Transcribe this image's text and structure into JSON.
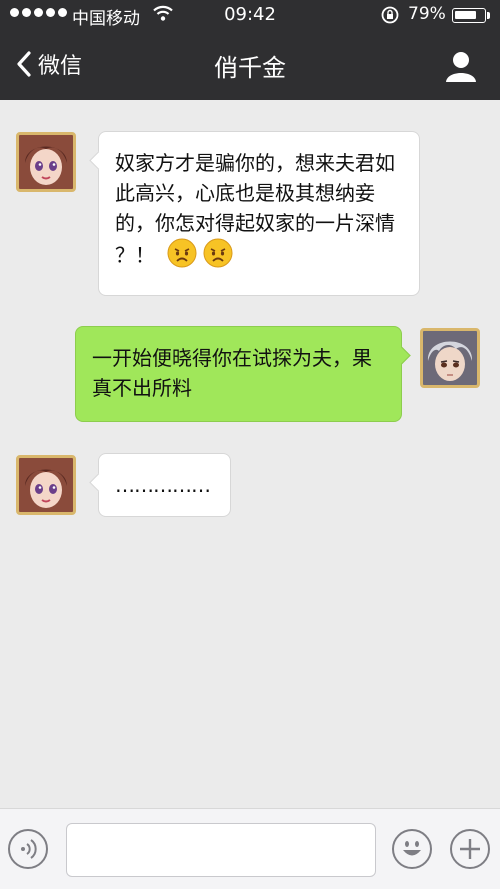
{
  "status_bar": {
    "carrier": "中国移动",
    "time": "09:42",
    "battery": "79%",
    "battery_level": 0.79
  },
  "nav": {
    "back_label": "微信",
    "title": "俏千金"
  },
  "messages": [
    {
      "side": "left",
      "text": "奴家方才是骗你的，想来夫君如此高兴，心底也是极其想纳妾的，你怎对得起奴家的一片深情 ？！"
    },
    {
      "side": "right",
      "text": "一开始便晓得你在试探为夫，果真不出所料"
    },
    {
      "side": "left",
      "text": "……………"
    }
  ],
  "colors": {
    "navbar_bg": "#2f2f31",
    "chat_bg": "#ebebeb",
    "outgoing_bubble": "#a0e75a",
    "incoming_bubble": "#ffffff"
  },
  "icons": [
    "back-chevron-icon",
    "contact-profile-icon",
    "voice-icon",
    "emoji-icon",
    "plus-icon",
    "wifi-icon",
    "rotation-lock-icon",
    "crying-face-emoji"
  ]
}
